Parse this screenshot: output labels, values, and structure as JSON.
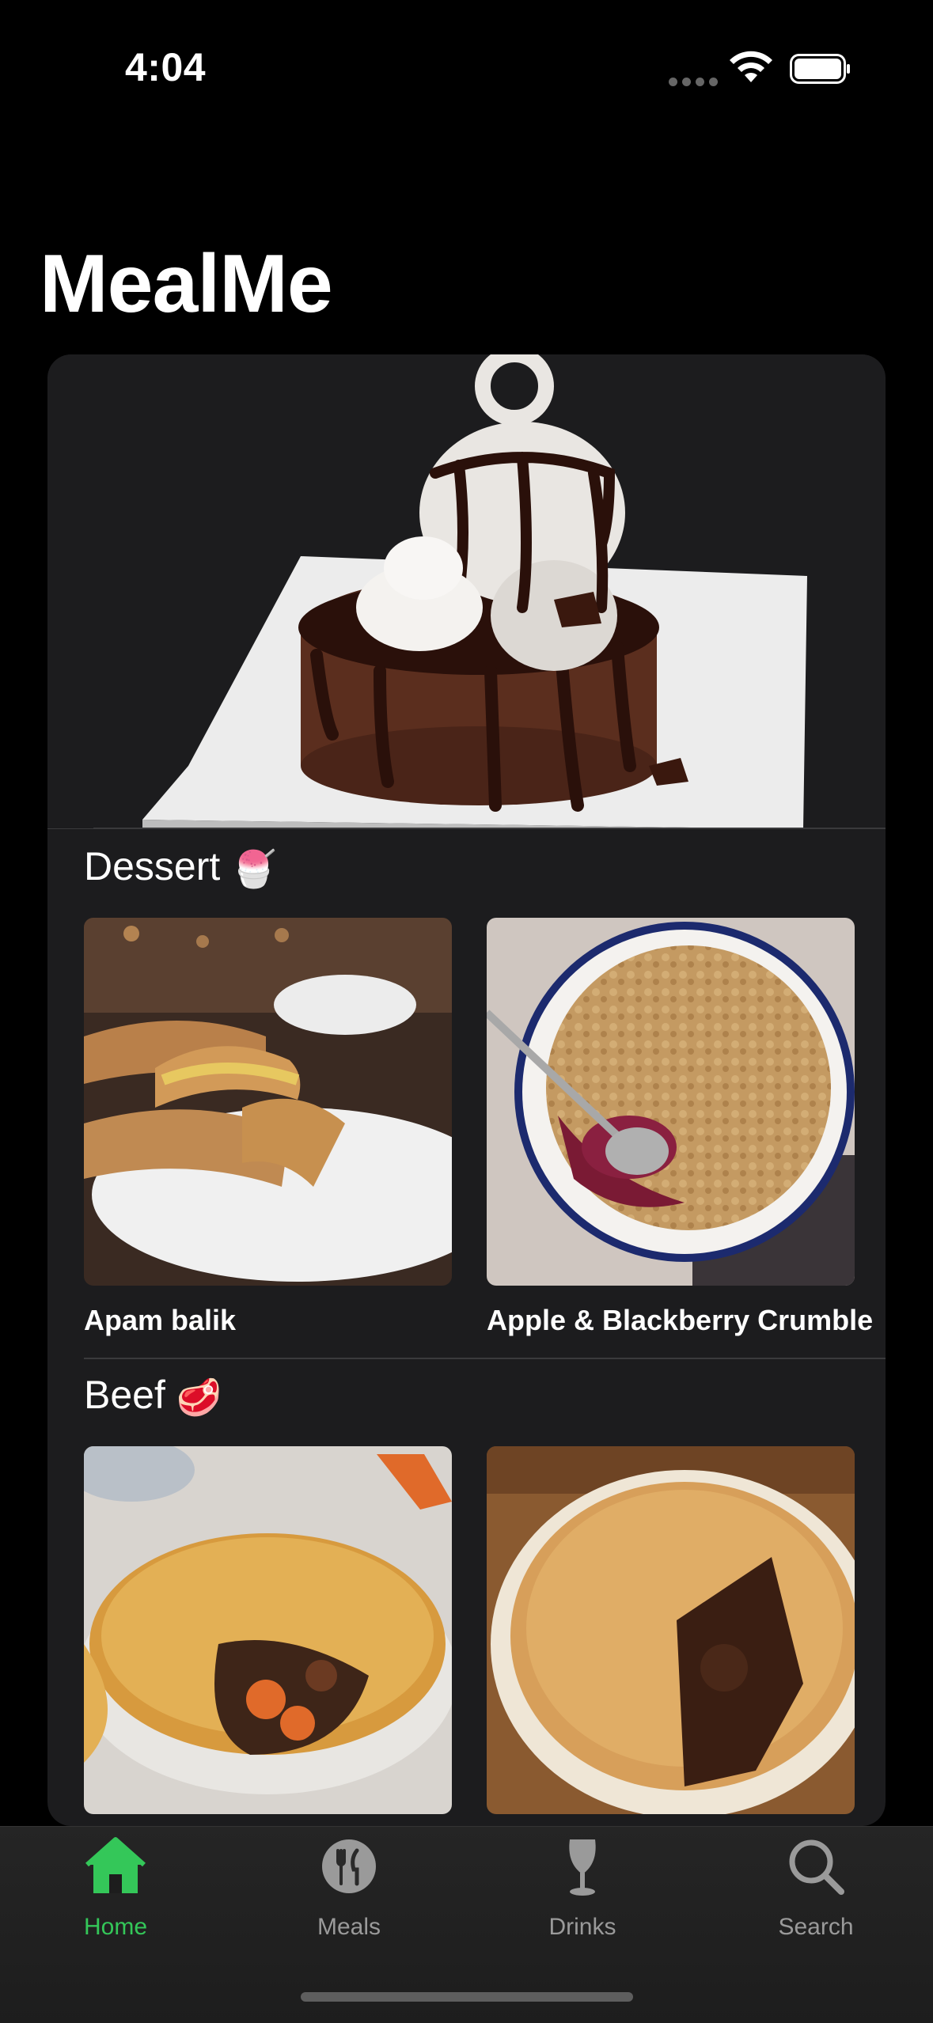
{
  "status_bar": {
    "time": "4:04"
  },
  "app": {
    "title": "MealMe"
  },
  "sections": [
    {
      "title": "Dessert",
      "emoji": "🍧",
      "meals": [
        {
          "name": "Apam balik",
          "image_icon": "apam-balik-photo"
        },
        {
          "name": "Apple & Blackberry Crumble",
          "image_icon": "crumble-photo"
        }
      ]
    },
    {
      "title": "Beef",
      "emoji": "🥩",
      "meals": [
        {
          "name": "",
          "image_icon": "beef-pie-photo"
        },
        {
          "name": "",
          "image_icon": "beef-pie-photo"
        }
      ]
    }
  ],
  "hero": {
    "image_icon": "dessert-hero-photo"
  },
  "tabs": [
    {
      "label": "Home",
      "icon": "house-icon",
      "active": true
    },
    {
      "label": "Meals",
      "icon": "fork-knife-icon",
      "active": false
    },
    {
      "label": "Drinks",
      "icon": "wine-glass-icon",
      "active": false
    },
    {
      "label": "Search",
      "icon": "magnifier-icon",
      "active": false
    }
  ],
  "colors": {
    "accent": "#34c759",
    "card": "#1c1c1e",
    "inactive": "#9a9a9a"
  }
}
